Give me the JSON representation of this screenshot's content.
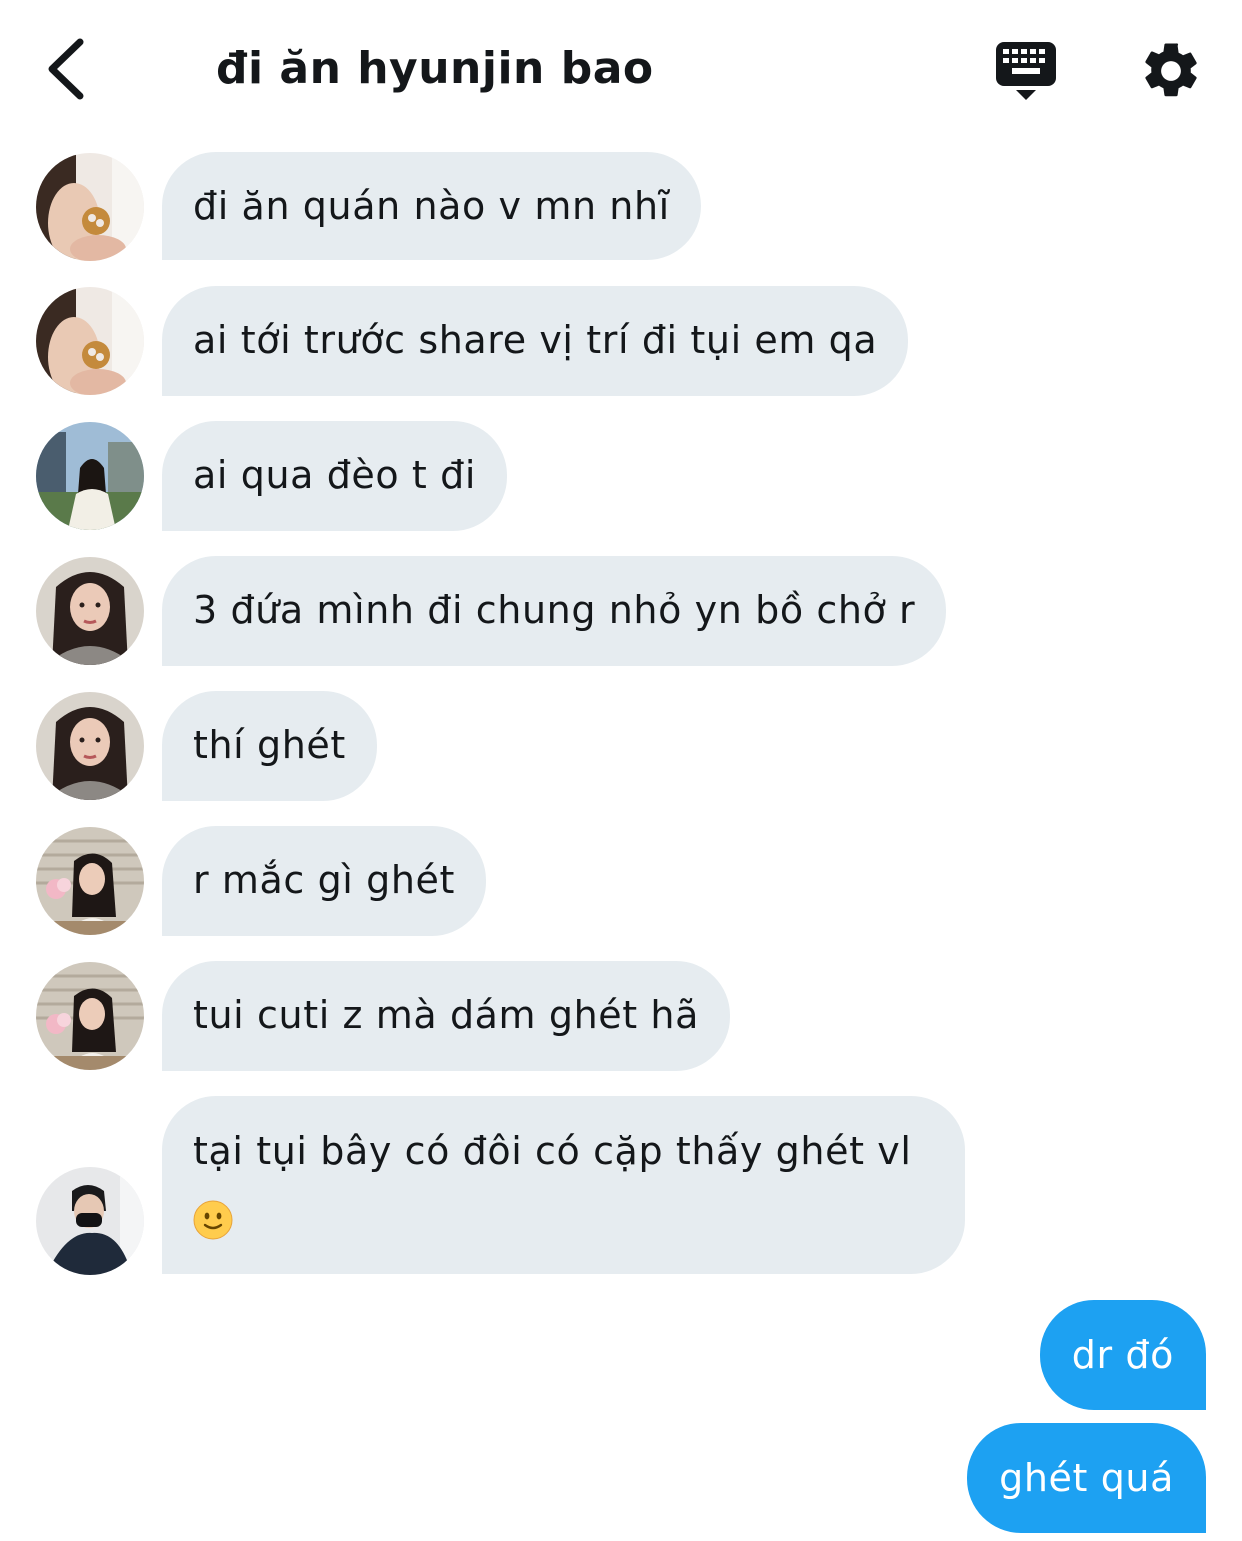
{
  "header": {
    "title": "đi ăn hyunjin bao",
    "back_icon": "chevron-left-icon",
    "keyboard_icon": "keyboard-icon",
    "settings_icon": "gear-icon"
  },
  "messages": [
    {
      "text": "đi ăn quán nào v mn nhĩ",
      "avatar": "user-avatar-1"
    },
    {
      "text": "ai tới trước share vị trí đi tụi em qa",
      "avatar": "user-avatar-1"
    },
    {
      "text": "ai qua đèo t đi",
      "avatar": "user-avatar-2"
    },
    {
      "text": "3 đứa mình đi chung nhỏ yn bồ chở r",
      "avatar": "user-avatar-3"
    },
    {
      "text": "thí ghét",
      "avatar": "user-avatar-3"
    },
    {
      "text": "r mắc gì ghét",
      "avatar": "user-avatar-4"
    },
    {
      "text": "tui cuti z mà dám ghét hã",
      "avatar": "user-avatar-4"
    },
    {
      "text": "tại tụi bây có đôi có cặp thấy ghét vl",
      "avatar": "user-avatar-5",
      "emoji": "slightly-smiling-face-icon"
    }
  ],
  "sent": [
    {
      "text": "dr đó"
    },
    {
      "text": "ghét quá"
    }
  ],
  "colors": {
    "received_bubble": "#e6ecf0",
    "sent_bubble": "#1da1f2",
    "text": "#14171a"
  }
}
